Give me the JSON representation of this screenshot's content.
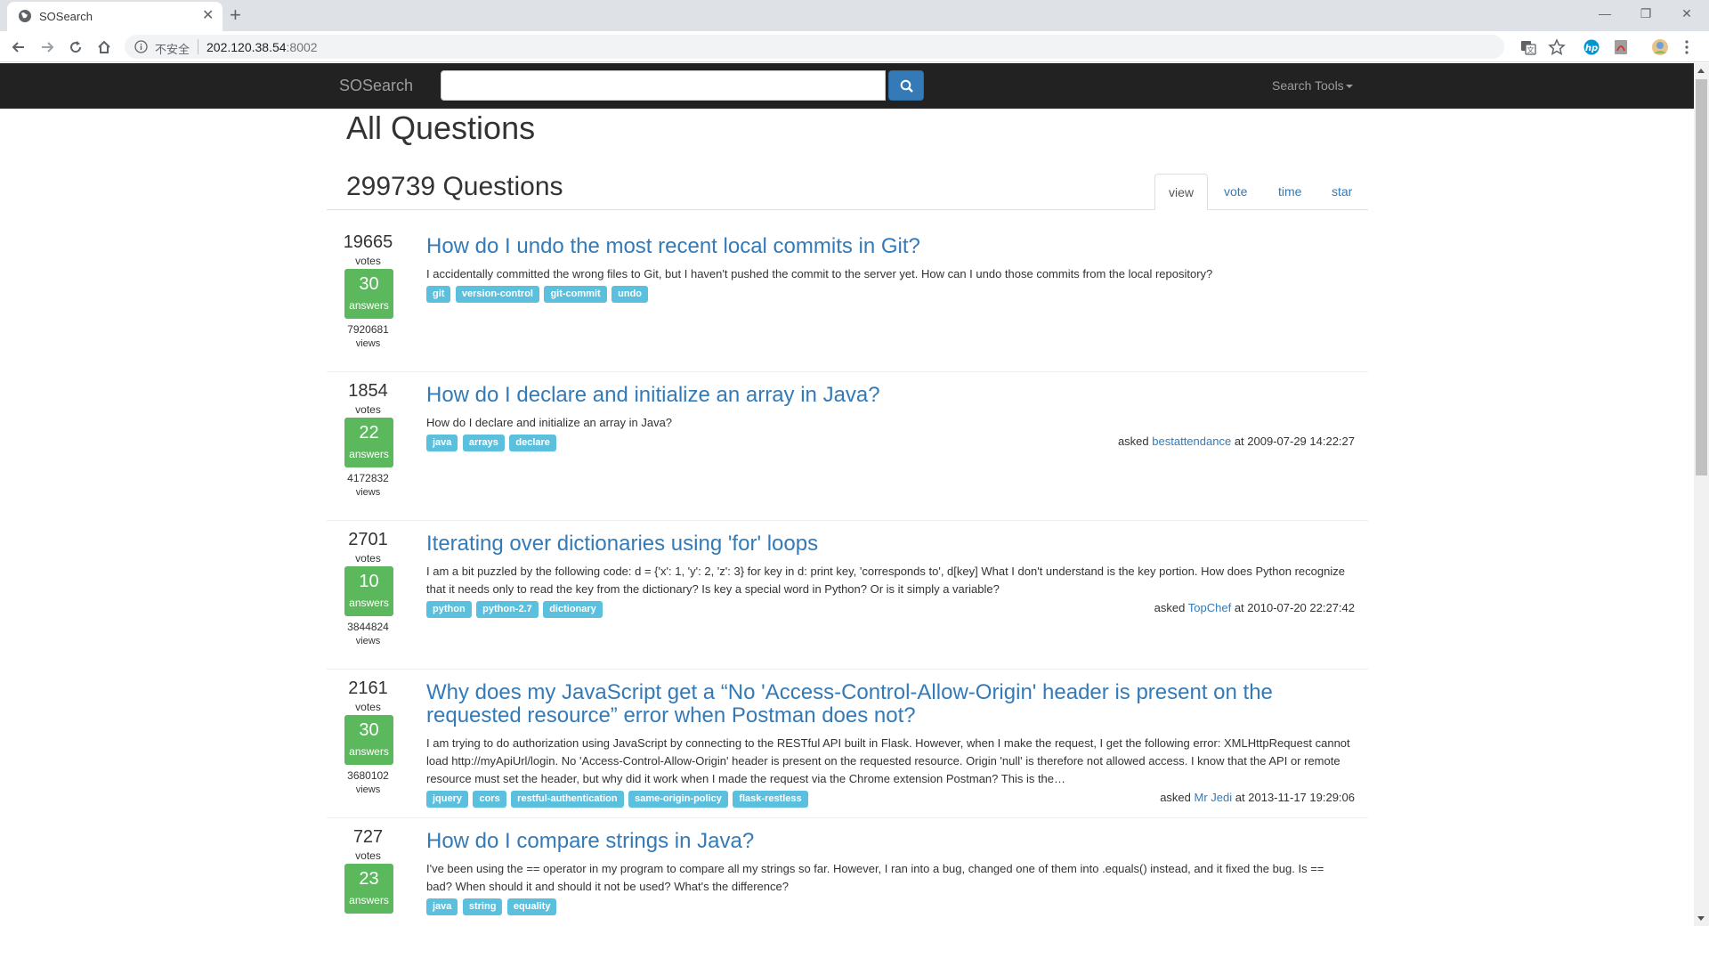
{
  "browser": {
    "tab_title": "SOSearch",
    "insecure_label": "不安全",
    "url_host": "202.120.38.54",
    "url_port": ":8002"
  },
  "navbar": {
    "brand": "SOSearch",
    "search_placeholder": "",
    "tools_label": "Search Tools"
  },
  "page": {
    "title": "All Questions",
    "count_title": "299739 Questions",
    "sort_tabs": [
      {
        "label": "view",
        "active": true
      },
      {
        "label": "vote",
        "active": false
      },
      {
        "label": "time",
        "active": false
      },
      {
        "label": "star",
        "active": false
      }
    ]
  },
  "labels": {
    "votes": "votes",
    "answers": "answers",
    "views": "views",
    "asked": "asked",
    "at": "at"
  },
  "questions": [
    {
      "votes": "19665",
      "answers": "30",
      "views": "7920681",
      "title": "How do I undo the most recent local commits in Git?",
      "excerpt": "I accidentally committed the wrong files to Git, but I haven't pushed the commit to the server yet. How can I undo those commits from the local repository?",
      "tags": [
        "git",
        "version-control",
        "git-commit",
        "undo"
      ],
      "asked_user": "",
      "asked_time": ""
    },
    {
      "votes": "1854",
      "answers": "22",
      "views": "4172832",
      "title": "How do I declare and initialize an array in Java?",
      "excerpt": "How do I declare and initialize an array in Java?",
      "tags": [
        "java",
        "arrays",
        "declare"
      ],
      "asked_user": "bestattendance",
      "asked_time": "2009-07-29 14:22:27"
    },
    {
      "votes": "2701",
      "answers": "10",
      "views": "3844824",
      "title": "Iterating over dictionaries using 'for' loops",
      "excerpt": "I am a bit puzzled by the following code: d = {'x': 1, 'y': 2, 'z': 3} for key in d: print key, 'corresponds to', d[key] What I don't understand is the key portion. How does Python recognize that it needs only to read the key from the dictionary? Is key a special word in Python? Or is it simply a variable?",
      "tags": [
        "python",
        "python-2.7",
        "dictionary"
      ],
      "asked_user": "TopChef",
      "asked_time": "2010-07-20 22:27:42"
    },
    {
      "votes": "2161",
      "answers": "30",
      "views": "3680102",
      "title": "Why does my JavaScript get a “No 'Access-Control-Allow-Origin' header is present on the requested resource” error when Postman does not?",
      "excerpt": "I am trying to do authorization using JavaScript by connecting to the RESTful API built in Flask. However, when I make the request, I get the following error: XMLHttpRequest cannot load http://myApiUrl/login. No 'Access-Control-Allow-Origin' header is present on the requested resource. Origin 'null' is therefore not allowed access. I know that the API or remote resource must set the header, but why did it work when I made the request via the Chrome extension Postman? This is the…",
      "tags": [
        "jquery",
        "cors",
        "restful-authentication",
        "same-origin-policy",
        "flask-restless"
      ],
      "asked_user": "Mr Jedi",
      "asked_time": "2013-11-17 19:29:06"
    },
    {
      "votes": "727",
      "answers": "23",
      "views": "",
      "title": "How do I compare strings in Java?",
      "excerpt": "I've been using the == operator in my program to compare all my strings so far. However, I ran into a bug, changed one of them into .equals() instead, and it fixed the bug. Is == bad? When should it and should it not be used? What's the difference?",
      "tags": [
        "java",
        "string",
        "equality"
      ],
      "asked_user": "",
      "asked_time": ""
    }
  ]
}
